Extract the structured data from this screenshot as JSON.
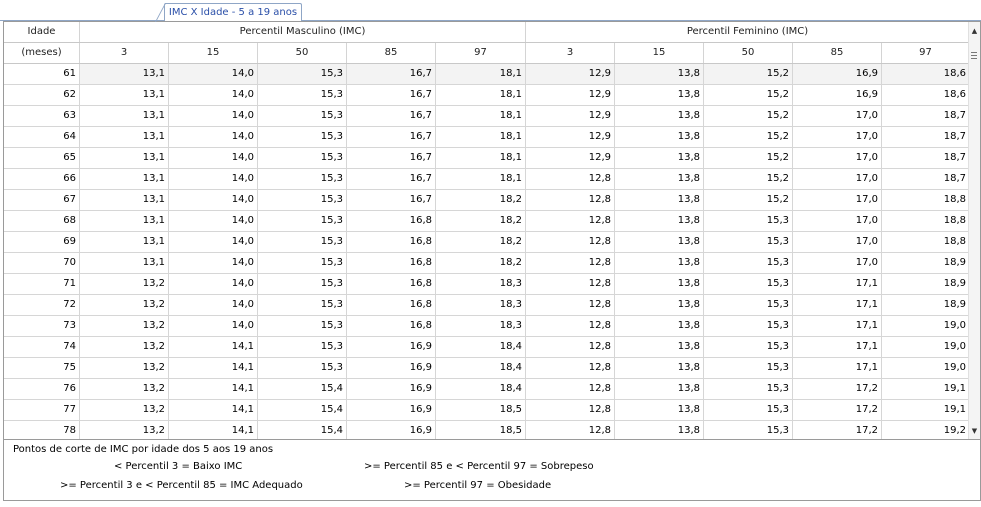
{
  "tab": {
    "label": "IMC X Idade - 5 a 19 anos"
  },
  "header": {
    "idade": "Idade",
    "meses": "(meses)",
    "masc_group": "Percentil Masculino (IMC)",
    "fem_group": "Percentil Feminino (IMC)",
    "masc_percentiles": [
      "3",
      "15",
      "50",
      "85",
      "97"
    ],
    "fem_percentiles": [
      "3",
      "15",
      "50",
      "85",
      "97"
    ]
  },
  "rows": [
    [
      "61",
      "13,1",
      "14,0",
      "15,3",
      "16,7",
      "18,1",
      "12,9",
      "13,8",
      "15,2",
      "16,9",
      "18,6"
    ],
    [
      "62",
      "13,1",
      "14,0",
      "15,3",
      "16,7",
      "18,1",
      "12,9",
      "13,8",
      "15,2",
      "16,9",
      "18,6"
    ],
    [
      "63",
      "13,1",
      "14,0",
      "15,3",
      "16,7",
      "18,1",
      "12,9",
      "13,8",
      "15,2",
      "17,0",
      "18,7"
    ],
    [
      "64",
      "13,1",
      "14,0",
      "15,3",
      "16,7",
      "18,1",
      "12,9",
      "13,8",
      "15,2",
      "17,0",
      "18,7"
    ],
    [
      "65",
      "13,1",
      "14,0",
      "15,3",
      "16,7",
      "18,1",
      "12,9",
      "13,8",
      "15,2",
      "17,0",
      "18,7"
    ],
    [
      "66",
      "13,1",
      "14,0",
      "15,3",
      "16,7",
      "18,1",
      "12,8",
      "13,8",
      "15,2",
      "17,0",
      "18,7"
    ],
    [
      "67",
      "13,1",
      "14,0",
      "15,3",
      "16,7",
      "18,2",
      "12,8",
      "13,8",
      "15,2",
      "17,0",
      "18,8"
    ],
    [
      "68",
      "13,1",
      "14,0",
      "15,3",
      "16,8",
      "18,2",
      "12,8",
      "13,8",
      "15,3",
      "17,0",
      "18,8"
    ],
    [
      "69",
      "13,1",
      "14,0",
      "15,3",
      "16,8",
      "18,2",
      "12,8",
      "13,8",
      "15,3",
      "17,0",
      "18,8"
    ],
    [
      "70",
      "13,1",
      "14,0",
      "15,3",
      "16,8",
      "18,2",
      "12,8",
      "13,8",
      "15,3",
      "17,0",
      "18,9"
    ],
    [
      "71",
      "13,2",
      "14,0",
      "15,3",
      "16,8",
      "18,3",
      "12,8",
      "13,8",
      "15,3",
      "17,1",
      "18,9"
    ],
    [
      "72",
      "13,2",
      "14,0",
      "15,3",
      "16,8",
      "18,3",
      "12,8",
      "13,8",
      "15,3",
      "17,1",
      "18,9"
    ],
    [
      "73",
      "13,2",
      "14,0",
      "15,3",
      "16,8",
      "18,3",
      "12,8",
      "13,8",
      "15,3",
      "17,1",
      "19,0"
    ],
    [
      "74",
      "13,2",
      "14,1",
      "15,3",
      "16,9",
      "18,4",
      "12,8",
      "13,8",
      "15,3",
      "17,1",
      "19,0"
    ],
    [
      "75",
      "13,2",
      "14,1",
      "15,3",
      "16,9",
      "18,4",
      "12,8",
      "13,8",
      "15,3",
      "17,1",
      "19,0"
    ],
    [
      "76",
      "13,2",
      "14,1",
      "15,4",
      "16,9",
      "18,4",
      "12,8",
      "13,8",
      "15,3",
      "17,2",
      "19,1"
    ],
    [
      "77",
      "13,2",
      "14,1",
      "15,4",
      "16,9",
      "18,5",
      "12,8",
      "13,8",
      "15,3",
      "17,2",
      "19,1"
    ],
    [
      "78",
      "13,2",
      "14,1",
      "15,4",
      "16,9",
      "18,5",
      "12,8",
      "13,8",
      "15,3",
      "17,2",
      "19,2"
    ]
  ],
  "legend": {
    "title": "Pontos de corte de IMC por idade dos 5 aos 19 anos",
    "low": "< Percentil 3 = Baixo IMC",
    "over": ">= Percentil 85 e < Percentil 97 = Sobrepeso",
    "adequate": ">= Percentil 3 e < Percentil 85 = IMC Adequado",
    "obese": ">= Percentil 97 = Obesidade"
  },
  "colors": {
    "tab_text": "#2a4fa8",
    "grid_line": "#d6d6d6",
    "border": "#9a9a9a"
  }
}
